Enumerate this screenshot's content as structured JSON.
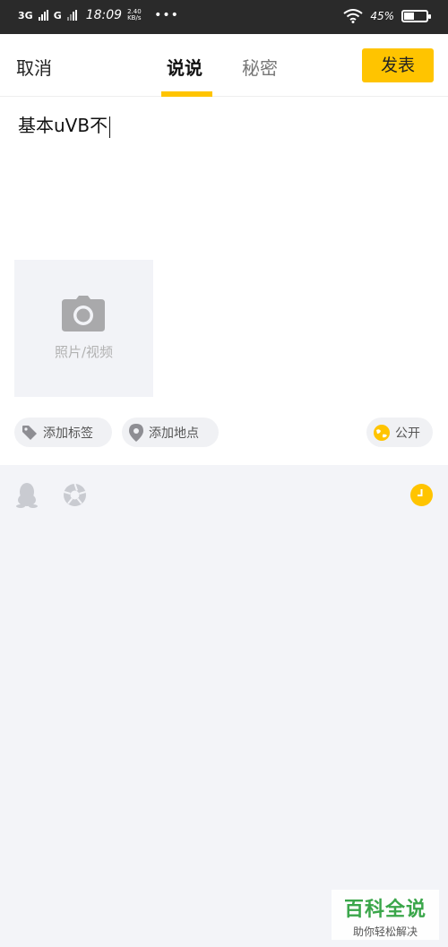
{
  "status_bar": {
    "network_1": "3G",
    "network_2": "G",
    "time": "18:09",
    "speed": "2.40 KB/s",
    "more": "•••",
    "battery": "45%",
    "battery_level": 0.45
  },
  "header": {
    "cancel_label": "取消",
    "tabs": [
      {
        "label": "说说",
        "active": true
      },
      {
        "label": "秘密",
        "active": false
      }
    ],
    "publish_label": "发表"
  },
  "compose": {
    "text": "基本uVB不"
  },
  "media": {
    "label": "照片/视频",
    "icon": "camera-icon"
  },
  "actions": {
    "add_tag": "添加标签",
    "add_location": "添加地点",
    "visibility": "公开"
  },
  "bottom_icons": [
    "qq-icon",
    "shutter-icon",
    "clock-icon"
  ],
  "watermark": {
    "main": "百科全说",
    "sub": "助你轻松解决"
  },
  "colors": {
    "accent": "#ffc400",
    "panel_bg": "#f3f4f8",
    "statusbar_bg": "#2a2a2a"
  }
}
